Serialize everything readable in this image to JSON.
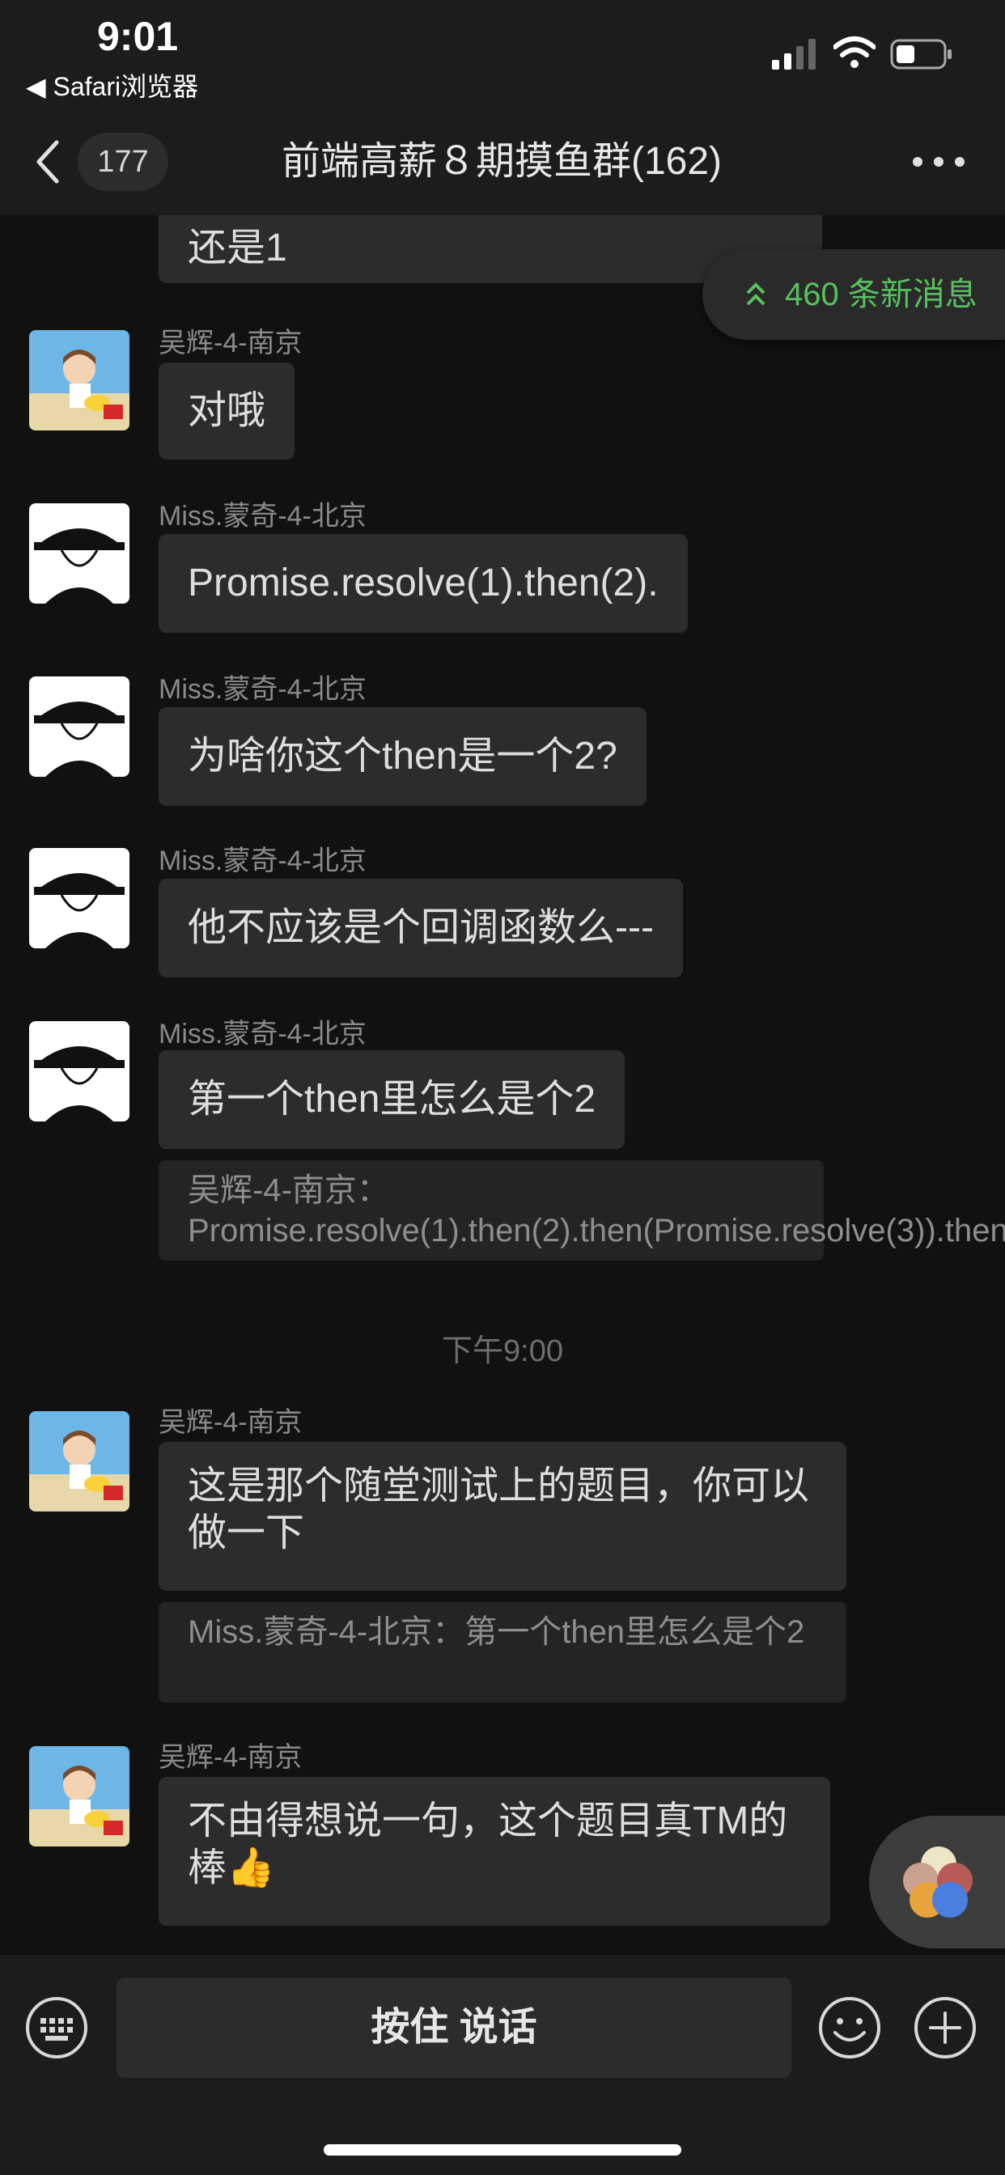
{
  "status_bar": {
    "time": "9:01",
    "back_app": "◀ Safari浏览器"
  },
  "nav": {
    "unread_count": "177",
    "title": "前端高薪８期摸鱼群(162)"
  },
  "new_messages": "460 条新消息",
  "messages": {
    "m0": {
      "text": "还是1"
    },
    "m1": {
      "sender": "吴辉-4-南京",
      "text": "对哦"
    },
    "m2": {
      "sender": "Miss.蒙奇-4-北京",
      "text": "Promise.resolve(1).then(2)."
    },
    "m3": {
      "sender": "Miss.蒙奇-4-北京",
      "text": "为啥你这个then是一个2?"
    },
    "m4": {
      "sender": "Miss.蒙奇-4-北京",
      "text": "他不应该是个回调函数么---"
    },
    "m5": {
      "sender": "Miss.蒙奇-4-北京",
      "text": "第一个then里怎么是个2",
      "quote": "吴辉-4-南京：Promise.resolve(1).then(2).then(Promise.resolve(3)).then(..."
    },
    "time_divider": "下午9:00",
    "m6": {
      "sender": "吴辉-4-南京",
      "text": "这是那个随堂测试上的题目，你可以做一下",
      "quote": "Miss.蒙奇-4-北京：第一个then里怎么是个2"
    },
    "m7": {
      "sender": "吴辉-4-南京",
      "text": "不由得想说一句，这个题目真TM的棒👍"
    }
  },
  "input_bar": {
    "hold_to_talk": "按住 说话"
  },
  "icons": [
    "chevron-left-icon",
    "more-icon",
    "keyboard-icon",
    "emoji-icon",
    "plus-icon",
    "double-chevron-up-icon",
    "signal-icon",
    "wifi-icon",
    "battery-icon"
  ],
  "colors": {
    "background": "#111111",
    "bubble": "#2c2c2c",
    "accent_green": "#58c15f"
  }
}
